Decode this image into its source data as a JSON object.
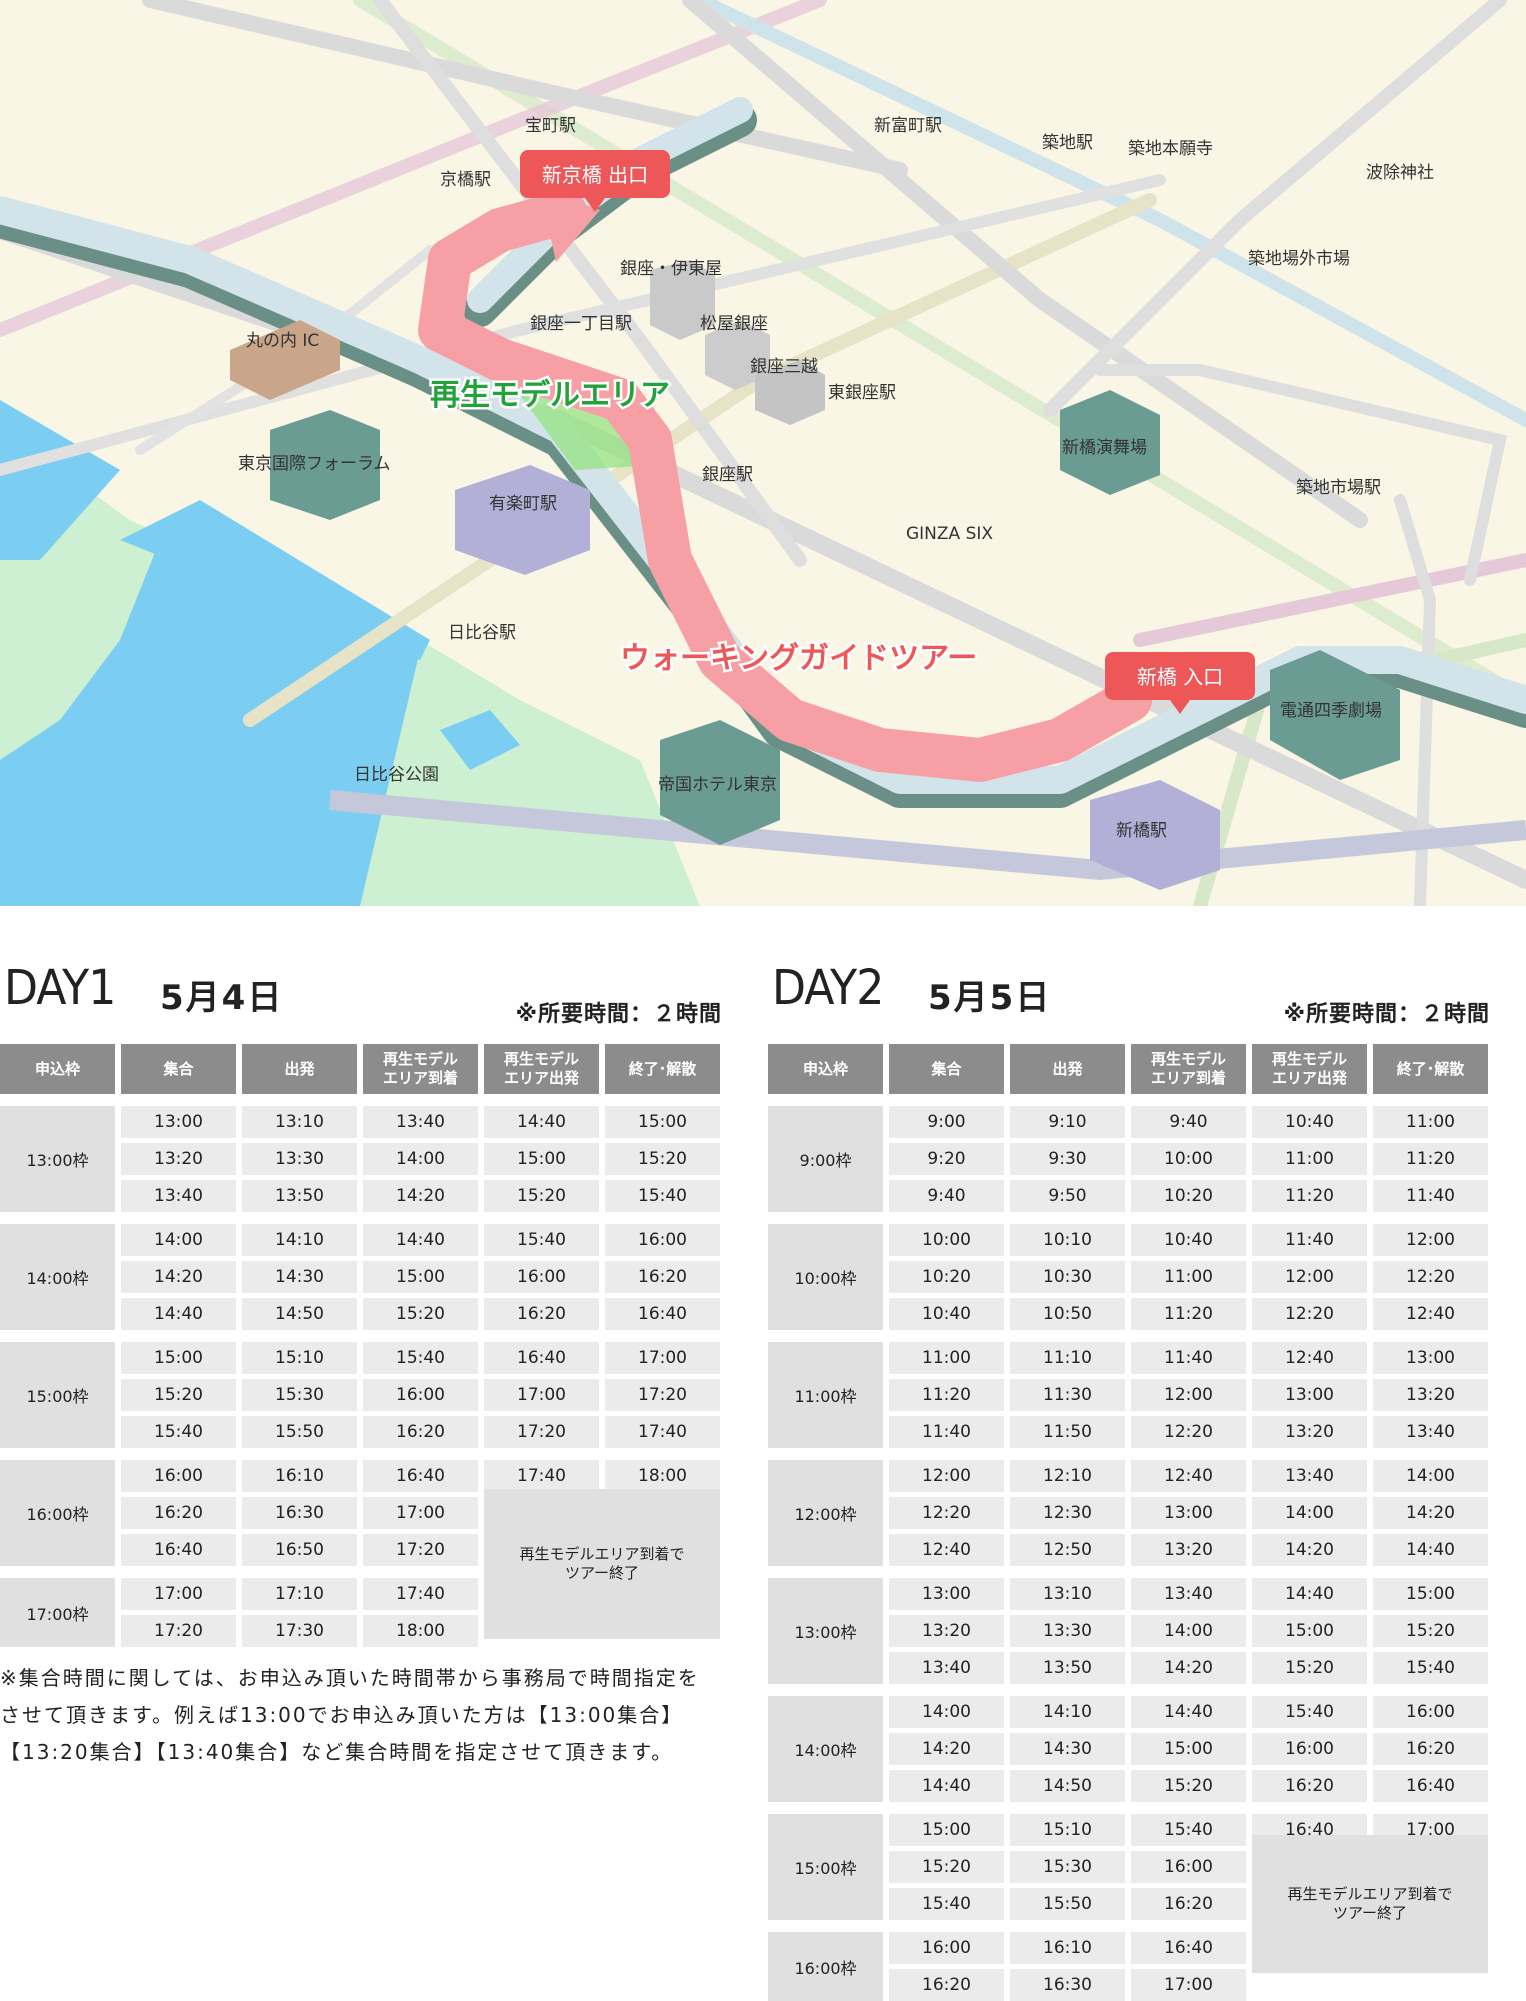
{
  "map": {
    "route_name": "ウォーキングガイドツアー",
    "area_name": "再生モデルエリア",
    "exit_label": "新京橋 出口",
    "entrance_label": "新橋 入口",
    "colors": {
      "route": "#f6a0a6",
      "pin": "#ee5757",
      "area": "#23a23a",
      "land": "#faf6e6",
      "water": "#7ccdf2",
      "park": "#cdefd2"
    },
    "places": {
      "takaracho": "宝町駅",
      "kyobashi": "京橋駅",
      "shintomicho": "新富町駅",
      "tsukiji": "築地駅",
      "tsukiji_hongwanji": "築地本願寺",
      "namiyoke": "波除神社",
      "tsukiji_outer": "築地場外市場",
      "ginza_itoya": "銀座・伊東屋",
      "ginza_itchome": "銀座一丁目駅",
      "matsuya": "松屋銀座",
      "mitsukoshi": "銀座三越",
      "higashi_ginza": "東銀座駅",
      "marunouchi_ic": "丸の内 IC",
      "forum": "東京国際フォーラム",
      "yurakucho": "有楽町駅",
      "ginza_station": "銀座駅",
      "shinbashi_enbujo": "新橋演舞場",
      "tsukijishijo": "築地市場駅",
      "ginza_six": "GINZA SIX",
      "hibiya": "日比谷駅",
      "dentsu": "電通四季劇場",
      "hibiya_park": "日比谷公園",
      "imperial_hotel": "帝国ホテル東京",
      "shinbashi": "新橋駅"
    }
  },
  "headers": [
    "申込枠",
    "集合",
    "出発",
    "再生モデル\nエリア到着",
    "再生モデル\nエリア出発",
    "終了･解散"
  ],
  "end_note": "再生モデルエリア到着で\nツアー終了",
  "day1": {
    "label": "DAY1",
    "date": "5月4日",
    "duration": "※所要時間：２時間",
    "blocks": [
      {
        "slot": "13:00枠",
        "rows": [
          [
            "13:00",
            "13:10",
            "13:40",
            "14:40",
            "15:00"
          ],
          [
            "13:20",
            "13:30",
            "14:00",
            "15:00",
            "15:20"
          ],
          [
            "13:40",
            "13:50",
            "14:20",
            "15:20",
            "15:40"
          ]
        ]
      },
      {
        "slot": "14:00枠",
        "rows": [
          [
            "14:00",
            "14:10",
            "14:40",
            "15:40",
            "16:00"
          ],
          [
            "14:20",
            "14:30",
            "15:00",
            "16:00",
            "16:20"
          ],
          [
            "14:40",
            "14:50",
            "15:20",
            "16:20",
            "16:40"
          ]
        ]
      },
      {
        "slot": "15:00枠",
        "rows": [
          [
            "15:00",
            "15:10",
            "15:40",
            "16:40",
            "17:00"
          ],
          [
            "15:20",
            "15:30",
            "16:00",
            "17:00",
            "17:20"
          ],
          [
            "15:40",
            "15:50",
            "16:20",
            "17:20",
            "17:40"
          ]
        ]
      },
      {
        "slot": "16:00枠",
        "rows": [
          [
            "16:00",
            "16:10",
            "16:40",
            "17:40",
            "18:00"
          ],
          [
            "16:20",
            "16:30",
            "17:00"
          ],
          [
            "16:40",
            "16:50",
            "17:20"
          ]
        ]
      },
      {
        "slot": "17:00枠",
        "rows": [
          [
            "17:00",
            "17:10",
            "17:40"
          ],
          [
            "17:20",
            "17:30",
            "18:00"
          ]
        ]
      }
    ]
  },
  "day2": {
    "label": "DAY2",
    "date": "5月5日",
    "duration": "※所要時間：２時間",
    "blocks": [
      {
        "slot": "9:00枠",
        "rows": [
          [
            "9:00",
            "9:10",
            "9:40",
            "10:40",
            "11:00"
          ],
          [
            "9:20",
            "9:30",
            "10:00",
            "11:00",
            "11:20"
          ],
          [
            "9:40",
            "9:50",
            "10:20",
            "11:20",
            "11:40"
          ]
        ]
      },
      {
        "slot": "10:00枠",
        "rows": [
          [
            "10:00",
            "10:10",
            "10:40",
            "11:40",
            "12:00"
          ],
          [
            "10:20",
            "10:30",
            "11:00",
            "12:00",
            "12:20"
          ],
          [
            "10:40",
            "10:50",
            "11:20",
            "12:20",
            "12:40"
          ]
        ]
      },
      {
        "slot": "11:00枠",
        "rows": [
          [
            "11:00",
            "11:10",
            "11:40",
            "12:40",
            "13:00"
          ],
          [
            "11:20",
            "11:30",
            "12:00",
            "13:00",
            "13:20"
          ],
          [
            "11:40",
            "11:50",
            "12:20",
            "13:20",
            "13:40"
          ]
        ]
      },
      {
        "slot": "12:00枠",
        "rows": [
          [
            "12:00",
            "12:10",
            "12:40",
            "13:40",
            "14:00"
          ],
          [
            "12:20",
            "12:30",
            "13:00",
            "14:00",
            "14:20"
          ],
          [
            "12:40",
            "12:50",
            "13:20",
            "14:20",
            "14:40"
          ]
        ]
      },
      {
        "slot": "13:00枠",
        "rows": [
          [
            "13:00",
            "13:10",
            "13:40",
            "14:40",
            "15:00"
          ],
          [
            "13:20",
            "13:30",
            "14:00",
            "15:00",
            "15:20"
          ],
          [
            "13:40",
            "13:50",
            "14:20",
            "15:20",
            "15:40"
          ]
        ]
      },
      {
        "slot": "14:00枠",
        "rows": [
          [
            "14:00",
            "14:10",
            "14:40",
            "15:40",
            "16:00"
          ],
          [
            "14:20",
            "14:30",
            "15:00",
            "16:00",
            "16:20"
          ],
          [
            "14:40",
            "14:50",
            "15:20",
            "16:20",
            "16:40"
          ]
        ]
      },
      {
        "slot": "15:00枠",
        "rows": [
          [
            "15:00",
            "15:10",
            "15:40",
            "16:40",
            "17:00"
          ],
          [
            "15:20",
            "15:30",
            "16:00"
          ],
          [
            "15:40",
            "15:50",
            "16:20"
          ]
        ]
      },
      {
        "slot": "16:00枠",
        "rows": [
          [
            "16:00",
            "16:10",
            "16:40"
          ],
          [
            "16:20",
            "16:30",
            "17:00"
          ]
        ]
      }
    ]
  },
  "note": "※集合時間に関しては、お申込み頂いた時間帯から事務局で時間指定をさせて頂きます。例えば13:00でお申込み頂いた方は【13:00集合】【13:20集合】【13:40集合】など集合時間を指定させて頂きます。"
}
